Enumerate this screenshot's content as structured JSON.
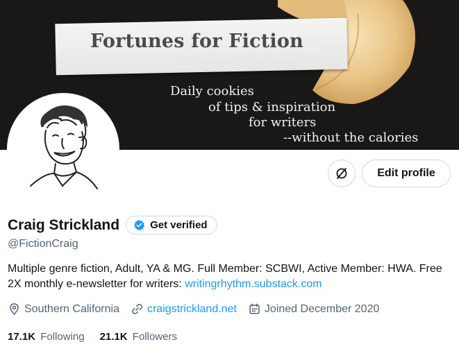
{
  "banner": {
    "title": "Fortunes for Fiction",
    "tagline": [
      "Daily cookies",
      "of tips & inspiration",
      "for writers",
      "--without the calories"
    ]
  },
  "actions": {
    "icon": "subscription-icon",
    "edit_profile": "Edit profile"
  },
  "profile": {
    "name": "Craig Strickland",
    "verify_label": "Get verified",
    "handle": "@FictionCraig",
    "bio_text": "Multiple genre fiction, Adult, YA & MG. Full Member: SCBWI, Active Member: HWA. Free 2X monthly e-newsletter for writers: ",
    "bio_link": "writingrhythm.substack.com",
    "location": "Southern California",
    "website": "craigstrickland.net",
    "joined": "Joined December 2020",
    "following_count": "17.1K",
    "following_label": "Following",
    "followers_count": "21.1K",
    "followers_label": "Followers"
  },
  "colors": {
    "link": "#1d9bf0",
    "secondary_text": "#536471",
    "border": "#cfd9de",
    "verified_badge": "#1d9bf0"
  }
}
